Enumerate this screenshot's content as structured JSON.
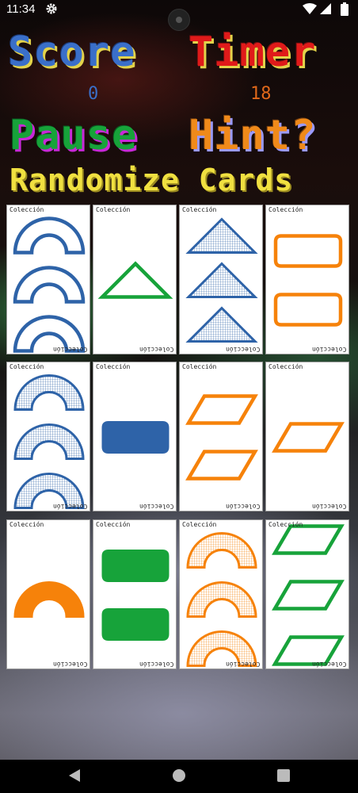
{
  "status_bar": {
    "time": "11:34"
  },
  "header": {
    "score_label": "Score",
    "timer_label": "Timer",
    "score_value": "0",
    "timer_value": "18",
    "pause_label": "Pause",
    "hint_label": "Hint?",
    "randomize_label": "Randomize Cards"
  },
  "card_text": "Colección",
  "colors": {
    "blue": "#2e63a8",
    "green": "#17a33a",
    "orange": "#f6820a"
  },
  "cards": [
    {
      "count": 3,
      "shape": "arch",
      "fill": "empty",
      "color": "blue"
    },
    {
      "count": 1,
      "shape": "triangle",
      "fill": "empty",
      "color": "green"
    },
    {
      "count": 3,
      "shape": "triangle",
      "fill": "striped",
      "color": "blue"
    },
    {
      "count": 2,
      "shape": "rectangle",
      "fill": "empty",
      "color": "orange"
    },
    {
      "count": 3,
      "shape": "arch",
      "fill": "striped",
      "color": "blue"
    },
    {
      "count": 1,
      "shape": "rectangle",
      "fill": "solid",
      "color": "blue"
    },
    {
      "count": 2,
      "shape": "parallelogram",
      "fill": "empty",
      "color": "orange"
    },
    {
      "count": 1,
      "shape": "parallelogram",
      "fill": "empty",
      "color": "orange"
    },
    {
      "count": 1,
      "shape": "arch",
      "fill": "solid",
      "color": "orange"
    },
    {
      "count": 2,
      "shape": "rectangle",
      "fill": "solid",
      "color": "green"
    },
    {
      "count": 3,
      "shape": "arch",
      "fill": "striped",
      "color": "orange"
    },
    {
      "count": 3,
      "shape": "parallelogram",
      "fill": "empty",
      "color": "green"
    }
  ]
}
